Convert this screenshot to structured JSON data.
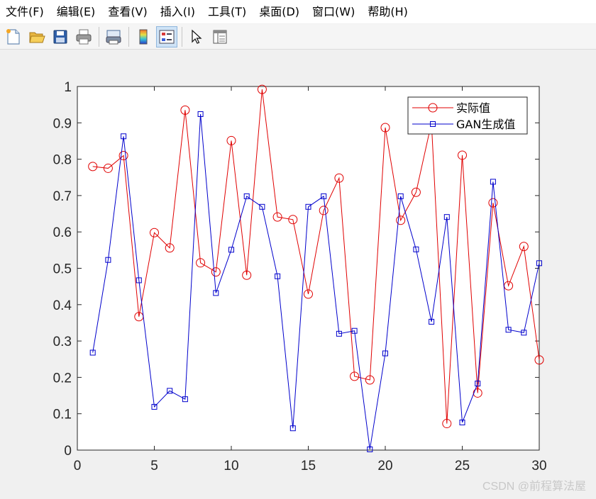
{
  "menu": {
    "items": [
      "文件(F)",
      "编辑(E)",
      "查看(V)",
      "插入(I)",
      "工具(T)",
      "桌面(D)",
      "窗口(W)",
      "帮助(H)"
    ]
  },
  "toolbar": {
    "buttons": [
      "new-figure-icon",
      "open-folder-icon",
      "save-icon",
      "print-icon",
      "print-preview-icon",
      "colorbar-icon",
      "legend-icon",
      "pointer-arrow-icon",
      "property-inspector-icon"
    ]
  },
  "colors": {
    "series_actual": "#e00000",
    "series_gan": "#0000cc"
  },
  "chart_data": {
    "type": "line",
    "xlim": [
      0,
      30
    ],
    "ylim": [
      0,
      1
    ],
    "xticks": [
      "0",
      "5",
      "10",
      "15",
      "20",
      "25",
      "30"
    ],
    "yticks": [
      "0",
      "0.1",
      "0.2",
      "0.3",
      "0.4",
      "0.5",
      "0.6",
      "0.7",
      "0.8",
      "0.9",
      "1"
    ],
    "grid": false,
    "legend_position": "top-right",
    "x": [
      1,
      2,
      3,
      4,
      5,
      6,
      7,
      8,
      9,
      10,
      11,
      12,
      13,
      14,
      15,
      16,
      17,
      18,
      19,
      20,
      21,
      22,
      23,
      24,
      25,
      26,
      27,
      28,
      29,
      30
    ],
    "series": [
      {
        "name": "实际值",
        "marker": "circle",
        "values": [
          0.78,
          0.775,
          0.81,
          0.367,
          0.598,
          0.556,
          0.935,
          0.515,
          0.49,
          0.851,
          0.481,
          0.992,
          0.641,
          0.634,
          0.429,
          0.659,
          0.748,
          0.203,
          0.193,
          0.887,
          0.632,
          0.709,
          0.9,
          0.073,
          0.811,
          0.157,
          0.68,
          0.452,
          0.56,
          0.248
        ]
      },
      {
        "name": "GAN生成值",
        "marker": "square",
        "values": [
          0.268,
          0.523,
          0.863,
          0.467,
          0.119,
          0.163,
          0.14,
          0.924,
          0.432,
          0.551,
          0.698,
          0.669,
          0.478,
          0.06,
          0.669,
          0.698,
          0.32,
          0.328,
          0.002,
          0.266,
          0.698,
          0.552,
          0.353,
          0.641,
          0.076,
          0.183,
          0.738,
          0.331,
          0.323,
          0.514
        ]
      }
    ]
  },
  "watermark": "CSDN @前程算法屋"
}
